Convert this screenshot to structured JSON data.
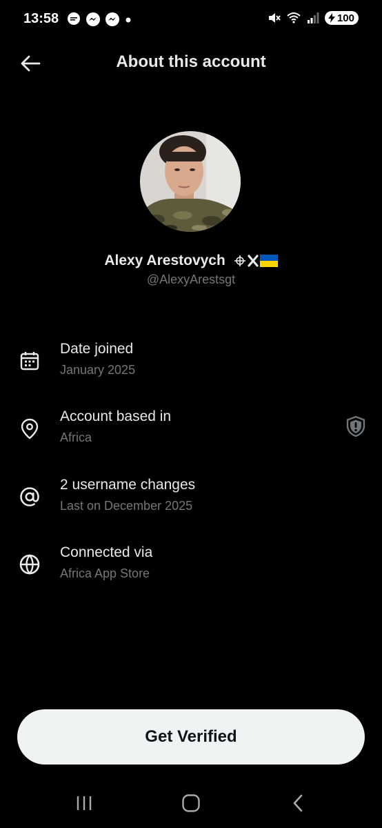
{
  "status_bar": {
    "time": "13:58",
    "battery": "100"
  },
  "header": {
    "title": "About this account"
  },
  "profile": {
    "display_name": "Alexy Arestovych",
    "handle": "@AlexyArestsgt"
  },
  "info": [
    {
      "icon": "calendar-icon",
      "title": "Date joined",
      "value": "January 2025"
    },
    {
      "icon": "location-pin-icon",
      "title": "Account based in",
      "value": "Africa"
    },
    {
      "icon": "at-sign-icon",
      "title": "2 username changes",
      "value": "Last on December 2025"
    },
    {
      "icon": "globe-icon",
      "title": "Connected via",
      "value": "Africa App Store"
    }
  ],
  "cta": {
    "label": "Get Verified"
  },
  "colors": {
    "background": "#000000",
    "primary_text": "#e7e9ea",
    "secondary_text": "#71767b",
    "button_bg": "#eff3f4",
    "button_text": "#0f1419"
  }
}
